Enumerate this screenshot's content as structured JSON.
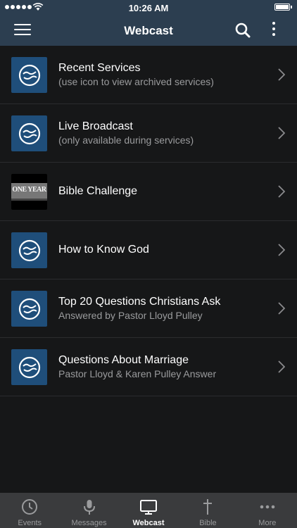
{
  "status_bar": {
    "time": "10:26 AM"
  },
  "header": {
    "title": "Webcast"
  },
  "items": [
    {
      "title": "Recent Services",
      "subtitle": "(use icon to view archived services)",
      "thumb": "church-logo"
    },
    {
      "title": "Live Broadcast",
      "subtitle": "(only available during services)",
      "thumb": "church-logo"
    },
    {
      "title": "Bible Challenge",
      "subtitle": "",
      "thumb": "one-year-photo",
      "thumb_text": "ONE YEAR"
    },
    {
      "title": "How to Know God",
      "subtitle": "",
      "thumb": "church-logo"
    },
    {
      "title": "Top 20 Questions Christians Ask",
      "subtitle": "Answered by Pastor Lloyd Pulley",
      "thumb": "church-logo"
    },
    {
      "title": "Questions About Marriage",
      "subtitle": "Pastor Lloyd & Karen Pulley Answer",
      "thumb": "church-logo"
    }
  ],
  "tabs": [
    {
      "label": "Events",
      "icon": "clock-icon",
      "active": false
    },
    {
      "label": "Messages",
      "icon": "microphone-icon",
      "active": false
    },
    {
      "label": "Webcast",
      "icon": "tv-icon",
      "active": true
    },
    {
      "label": "Bible",
      "icon": "cross-icon",
      "active": false
    },
    {
      "label": "More",
      "icon": "more-icon",
      "active": false
    }
  ],
  "colors": {
    "nav_bar": "#2c3e50",
    "background": "#161718",
    "thumb_blue": "#1f4e7a",
    "tab_bar": "#3a3b3d",
    "secondary_text": "#9a9b9d"
  }
}
